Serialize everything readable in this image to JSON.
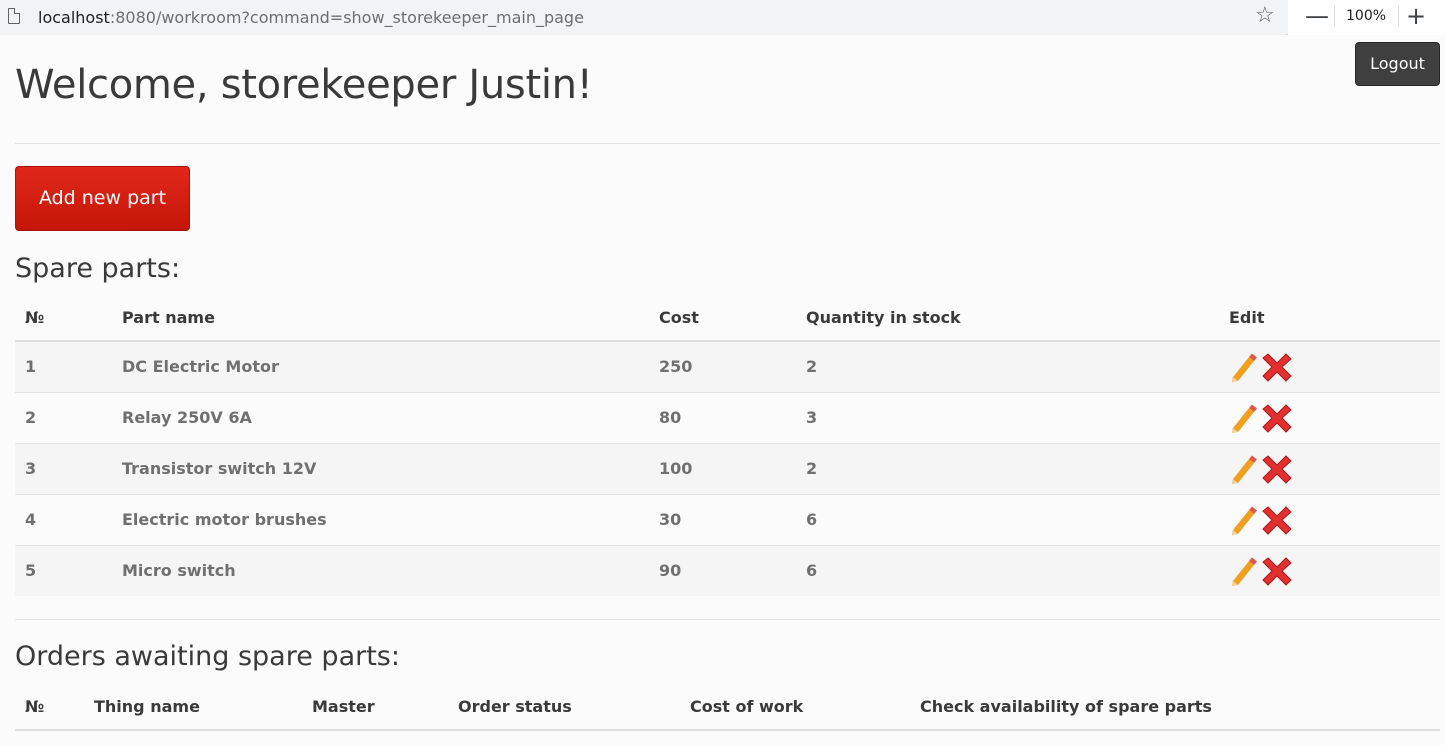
{
  "browser": {
    "url_host": "localhost",
    "url_rest": ":8080/workroom?command=show_storekeeper_main_page",
    "zoom_level": "100%",
    "zoom_minus": "—",
    "zoom_plus": "+"
  },
  "header": {
    "logout_label": "Logout",
    "welcome": "Welcome, storekeeper Justin!"
  },
  "actions": {
    "add_part_label": "Add new part"
  },
  "spare_parts": {
    "title": "Spare parts:",
    "columns": [
      "№",
      "Part name",
      "Cost",
      "Quantity in stock",
      "Edit"
    ],
    "rows": [
      {
        "no": "1",
        "name": "DC Electric Motor",
        "cost": "250",
        "qty": "2"
      },
      {
        "no": "2",
        "name": "Relay 250V 6A",
        "cost": "80",
        "qty": "3"
      },
      {
        "no": "3",
        "name": "Transistor switch 12V",
        "cost": "100",
        "qty": "2"
      },
      {
        "no": "4",
        "name": "Electric motor brushes",
        "cost": "30",
        "qty": "6"
      },
      {
        "no": "5",
        "name": "Micro switch",
        "cost": "90",
        "qty": "6"
      }
    ],
    "edit_icon": "pencil-icon",
    "delete_icon": "delete-x-icon"
  },
  "orders": {
    "title": "Orders awaiting spare parts:",
    "columns": [
      "№",
      "Thing name",
      "Master",
      "Order status",
      "Cost of work",
      "Check availability of spare parts"
    ]
  },
  "colors": {
    "add_button": "#d11f10",
    "logout_button": "#3f3f3f",
    "pencil": "#f0a020",
    "delete": "#e03030"
  }
}
